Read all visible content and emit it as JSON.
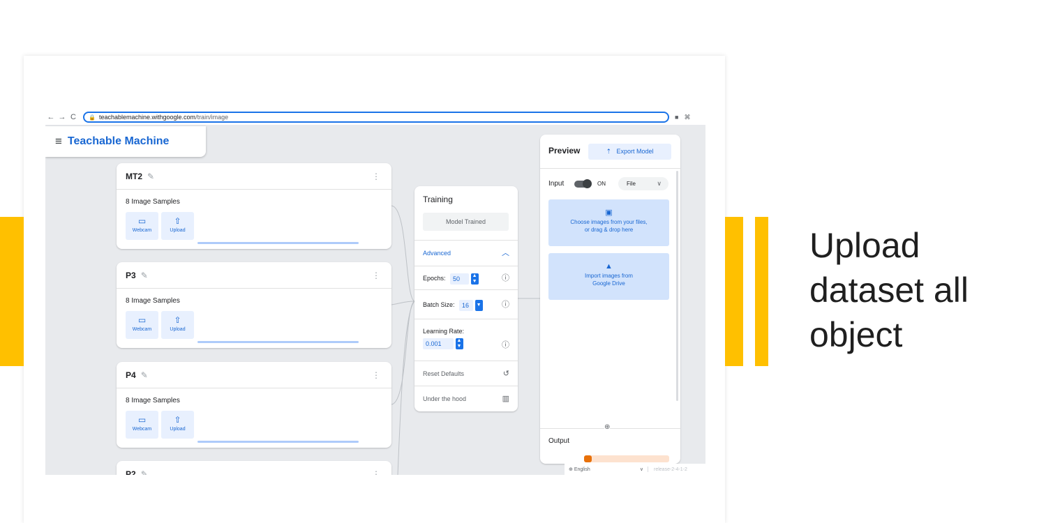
{
  "slide": {
    "title": "Upload dataset all object",
    "accent_color": "#FFC000"
  },
  "browser": {
    "back_icon": "arrow-left-icon",
    "forward_icon": "arrow-right-icon",
    "reload_icon": "reload-icon",
    "url_host": "teachablemachine.withgoogle.com",
    "url_path": "/train/image"
  },
  "app": {
    "name": "Teachable Machine",
    "brand_color": "#1967d2"
  },
  "classes": [
    {
      "name": "MT2",
      "samples": "8 Image Samples",
      "webcam": "Webcam",
      "upload": "Upload"
    },
    {
      "name": "P3",
      "samples": "8 Image Samples",
      "webcam": "Webcam",
      "upload": "Upload"
    },
    {
      "name": "P4",
      "samples": "8 Image Samples",
      "webcam": "Webcam",
      "upload": "Upload"
    },
    {
      "name": "P2"
    }
  ],
  "training": {
    "title": "Training",
    "button": "Model Trained",
    "advanced": "Advanced",
    "epochs_label": "Epochs:",
    "epochs_value": "50",
    "batch_label": "Batch Size:",
    "batch_value": "16",
    "lr_label": "Learning Rate:",
    "lr_value": "0.001",
    "reset": "Reset Defaults",
    "hood": "Under the hood"
  },
  "preview": {
    "title": "Preview",
    "export": "Export Model",
    "input_label": "Input",
    "toggle_state": "ON",
    "source_select": "File",
    "choose_line1": "Choose images from your files,",
    "choose_line2": "or drag & drop here",
    "drive_line1": "Import images from",
    "drive_line2": "Google Drive",
    "output_label": "Output"
  },
  "footer": {
    "language": "English",
    "release": "release-2-4-1-2"
  }
}
